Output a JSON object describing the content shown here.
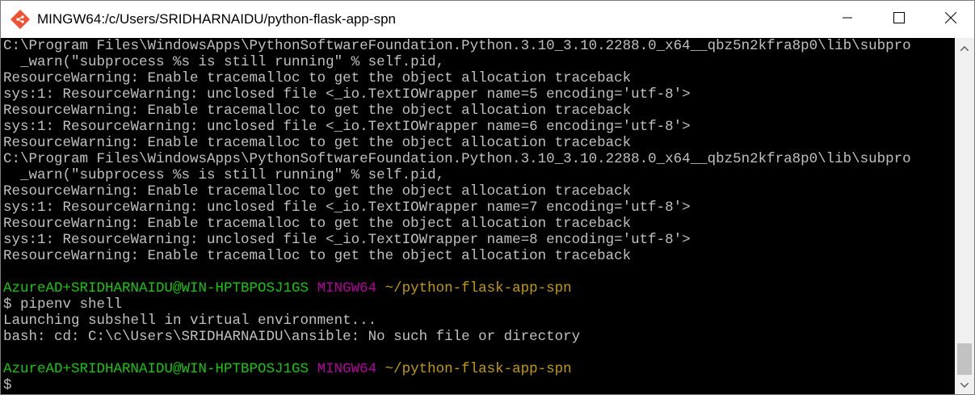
{
  "window": {
    "title": "MINGW64:/c/Users/SRIDHARNAIDU/python-flask-app-spn",
    "icon": "git-bash-icon",
    "controls": [
      "minimize-icon",
      "maximize-icon",
      "close-icon"
    ]
  },
  "colors": {
    "background": "#000000",
    "text": "#c0c0c0",
    "prompt_user": "#16c60c",
    "prompt_system": "#b4009e",
    "prompt_path": "#c19c00"
  },
  "terminal": {
    "lines": [
      "C:\\Program Files\\WindowsApps\\PythonSoftwareFoundation.Python.3.10_3.10.2288.0_x64__qbz5n2kfra8p0\\lib\\subpro",
      "  _warn(\"subprocess %s is still running\" % self.pid,",
      "ResourceWarning: Enable tracemalloc to get the object allocation traceback",
      "sys:1: ResourceWarning: unclosed file <_io.TextIOWrapper name=5 encoding='utf-8'>",
      "ResourceWarning: Enable tracemalloc to get the object allocation traceback",
      "sys:1: ResourceWarning: unclosed file <_io.TextIOWrapper name=6 encoding='utf-8'>",
      "ResourceWarning: Enable tracemalloc to get the object allocation traceback",
      "C:\\Program Files\\WindowsApps\\PythonSoftwareFoundation.Python.3.10_3.10.2288.0_x64__qbz5n2kfra8p0\\lib\\subpro",
      "  _warn(\"subprocess %s is still running\" % self.pid,",
      "ResourceWarning: Enable tracemalloc to get the object allocation traceback",
      "sys:1: ResourceWarning: unclosed file <_io.TextIOWrapper name=7 encoding='utf-8'>",
      "ResourceWarning: Enable tracemalloc to get the object allocation traceback",
      "sys:1: ResourceWarning: unclosed file <_io.TextIOWrapper name=8 encoding='utf-8'>",
      "ResourceWarning: Enable tracemalloc to get the object allocation traceback"
    ],
    "prompt1": {
      "user": "AzureAD+SRIDHARNAIDU@WIN-HPTBPOSJ1GS",
      "system": "MINGW64",
      "path": "~/python-flask-app-spn"
    },
    "command1": "$ pipenv shell",
    "output1": [
      "Launching subshell in virtual environment...",
      "bash: cd: C:\\c\\Users\\SRIDHARNAIDU\\ansible: No such file or directory"
    ],
    "prompt2": {
      "user": "AzureAD+SRIDHARNAIDU@WIN-HPTBPOSJ1GS",
      "system": "MINGW64",
      "path": "~/python-flask-app-spn"
    },
    "command2": "$ "
  }
}
